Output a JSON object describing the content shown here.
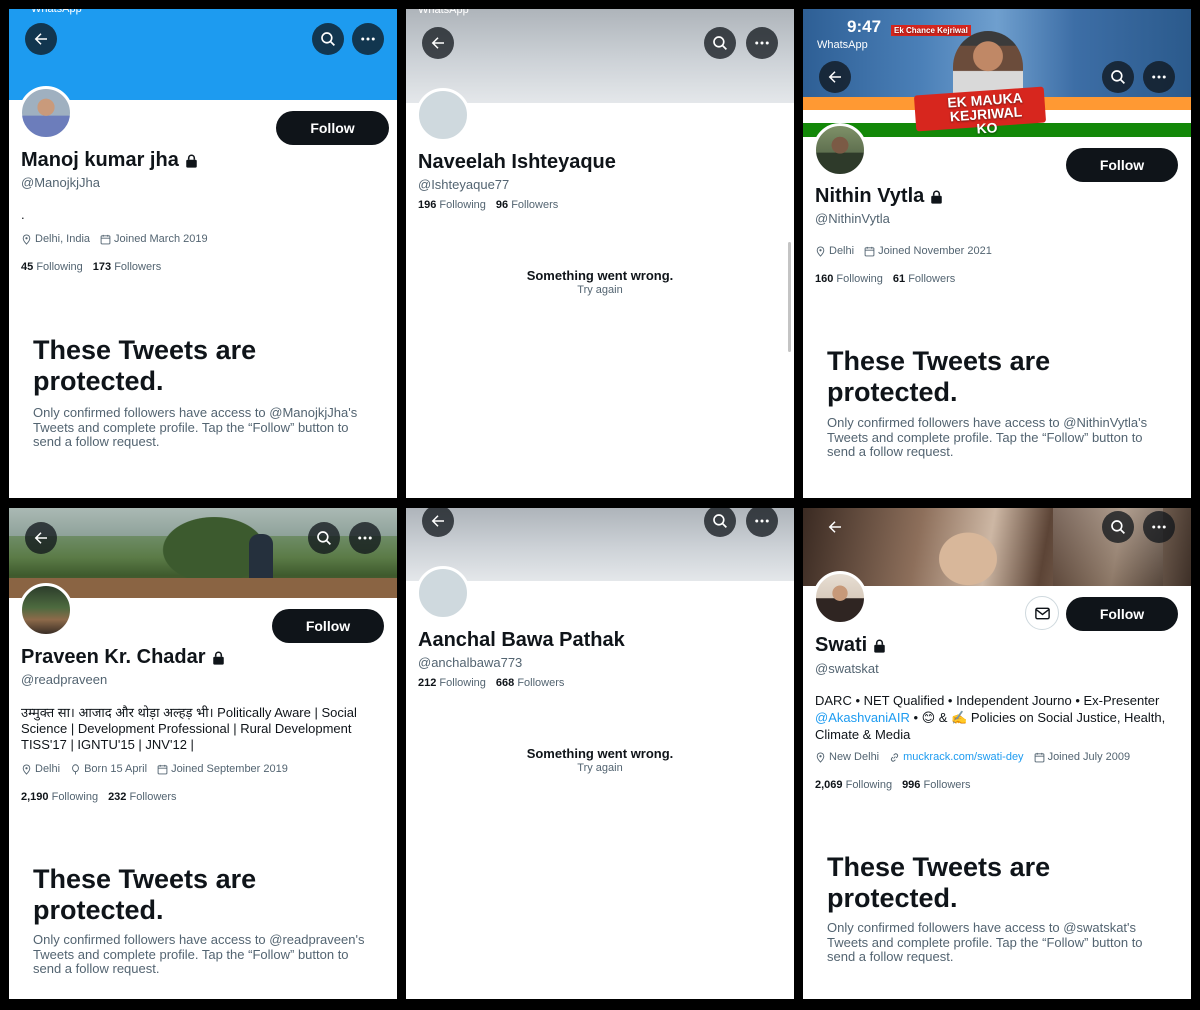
{
  "status": {
    "app_back": "WhatsApp",
    "time": "9:47"
  },
  "buttons": {
    "follow": "Follow"
  },
  "error": {
    "title": "Something went wrong.",
    "retry": "Try again"
  },
  "protected_title": "These Tweets are protected.",
  "profiles": [
    {
      "name": "Manoj kumar jha",
      "handle": "@ManojkjJha",
      "bio": ".",
      "location": "Delhi, India",
      "joined": "Joined March 2019",
      "following": "45",
      "followers": "173",
      "following_label": "Following",
      "followers_label": "Followers",
      "protected_body": "Only confirmed followers have access to @ManojkjJha's Tweets and complete profile. Tap the “Follow” button to send a follow request."
    },
    {
      "name": "Naveelah Ishteyaque",
      "handle": "@Ishteyaque77",
      "following": "196",
      "followers": "96",
      "following_label": "Following",
      "followers_label": "Followers"
    },
    {
      "name": "Nithin Vytla",
      "handle": "@NithinVytla",
      "location": "Delhi",
      "joined": "Joined November 2021",
      "following": "160",
      "followers": "61",
      "following_label": "Following",
      "followers_label": "Followers",
      "banner_text": "EK MAUKA KEJRIWAL KO",
      "banner_text2": "Ek Chance Kejriwal",
      "protected_body": "Only confirmed followers have access to @NithinVytla's Tweets and complete profile. Tap the “Follow” button to send a follow request."
    },
    {
      "name": "Praveen Kr. Chadar",
      "handle": "@readpraveen",
      "bio": "उम्मुक्त सा। आजाद और थोड़ा अल्हड़ भी। Politically Aware | Social Science | Development Professional | Rural Development TISS'17 | IGNTU'15 | JNV'12 |",
      "location": "Delhi",
      "born": "Born 15 April",
      "joined": "Joined September 2019",
      "following": "2,190",
      "followers": "232",
      "following_label": "Following",
      "followers_label": "Followers",
      "protected_body": "Only confirmed followers have access to @readpraveen's Tweets and complete profile. Tap the “Follow” button to send a follow request."
    },
    {
      "name": "Aanchal Bawa Pathak",
      "handle": "@anchalbawa773",
      "following": "212",
      "followers": "668",
      "following_label": "Following",
      "followers_label": "Followers"
    },
    {
      "name": "Swati",
      "handle": "@swatskat",
      "bio_line1": "DARC • NET Qualified • Independent Journo • Ex-Presenter",
      "bio_mention": "@AkashvaniAIR",
      "bio_line2_rest": " • 😊 & ✍️ Policies on Social Justice, Health, Climate & Media",
      "location": "New Delhi",
      "website": "muckrack.com/swati-dey",
      "joined": "Joined July 2009",
      "following": "2,069",
      "followers": "996",
      "following_label": "Following",
      "followers_label": "Followers",
      "protected_body": "Only confirmed followers have access to @swatskat's Tweets and complete profile. Tap the “Follow” button to send a follow request."
    }
  ],
  "colors": {
    "twitter_blue": "#1d9bf0",
    "text_primary": "#0f1419",
    "text_secondary": "#536471",
    "button_dark": "#0f1419"
  },
  "icons": [
    "back-arrow-icon",
    "search-icon",
    "more-icon",
    "lock-icon",
    "location-icon",
    "calendar-icon",
    "balloon-icon",
    "link-icon",
    "mail-icon"
  ]
}
